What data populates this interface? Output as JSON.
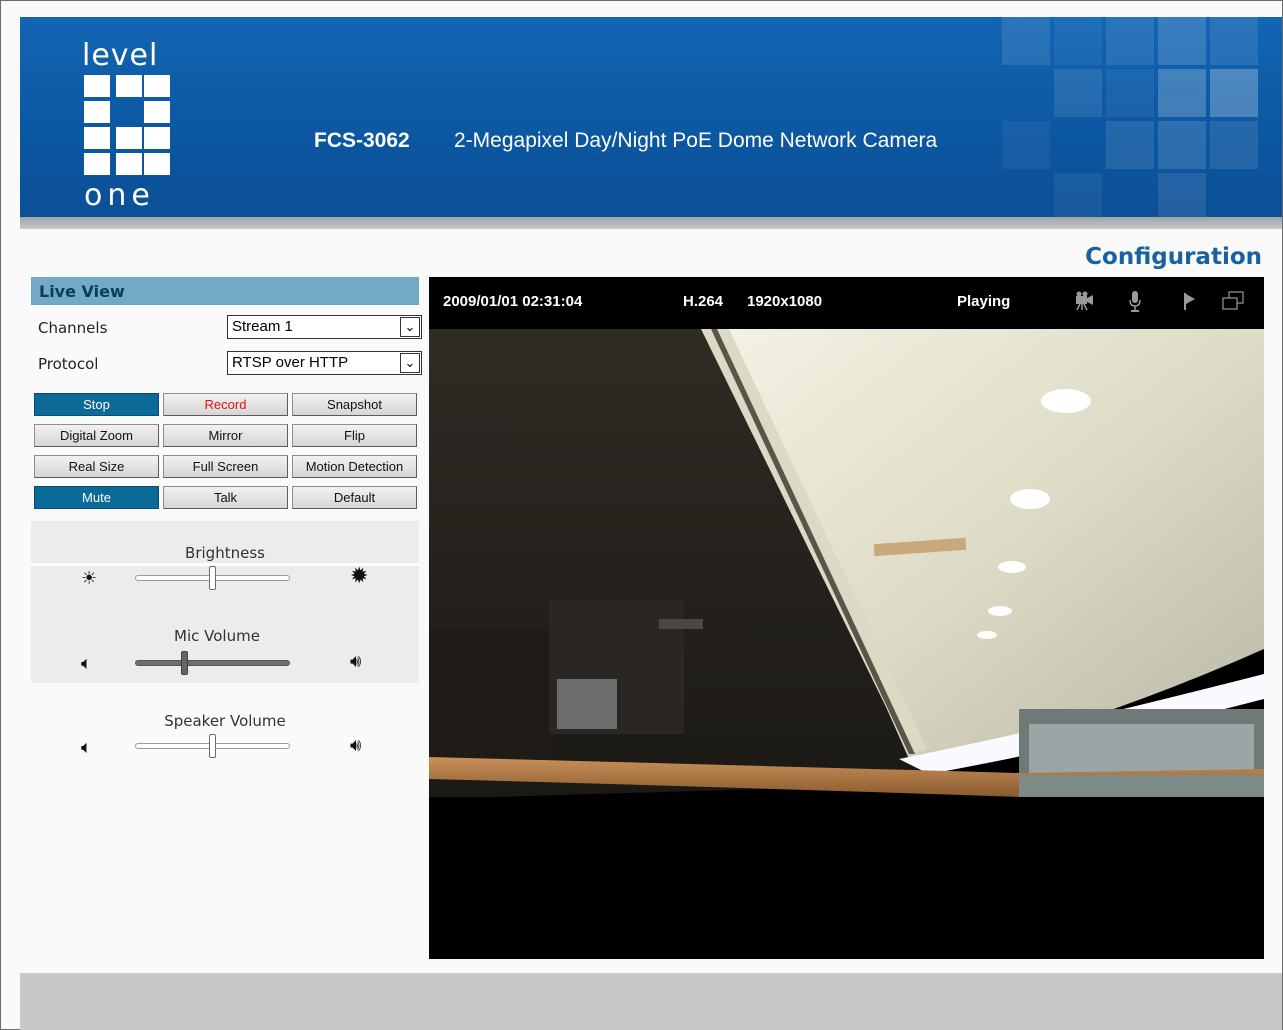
{
  "header": {
    "logo_top": "level",
    "logo_bottom": "one",
    "model": "FCS-3062",
    "description": "2-Megapixel Day/Night PoE Dome Network Camera"
  },
  "config_link": "Configuration",
  "live_view": {
    "title": "Live View",
    "channels_label": "Channels",
    "channels_value": "Stream 1",
    "protocol_label": "Protocol",
    "protocol_value": "RTSP over HTTP",
    "buttons": {
      "stop": "Stop",
      "record": "Record",
      "snapshot": "Snapshot",
      "digital_zoom": "Digital Zoom",
      "mirror": "Mirror",
      "flip": "Flip",
      "real_size": "Real Size",
      "full_screen": "Full Screen",
      "motion_detection": "Motion Detection",
      "mute": "Mute",
      "talk": "Talk",
      "default": "Default"
    },
    "sliders": {
      "brightness_label": "Brightness",
      "brightness_level": 0.5,
      "mic_label": "Mic Volume",
      "mic_level": 0.32,
      "speaker_label": "Speaker Volume",
      "speaker_level": 0.5
    }
  },
  "video": {
    "timestamp": "2009/01/01  02:31:04",
    "codec": "H.264",
    "resolution": "1920x1080",
    "status": "Playing",
    "icons": [
      "record-camera-icon",
      "microphone-icon",
      "flag-icon",
      "window-icon"
    ]
  },
  "colors": {
    "banner": "#0d5aa5",
    "active_button": "#0b6a97",
    "panel_header": "#72aac5",
    "config_link": "#1a61a2",
    "record_text": "#e31212"
  }
}
